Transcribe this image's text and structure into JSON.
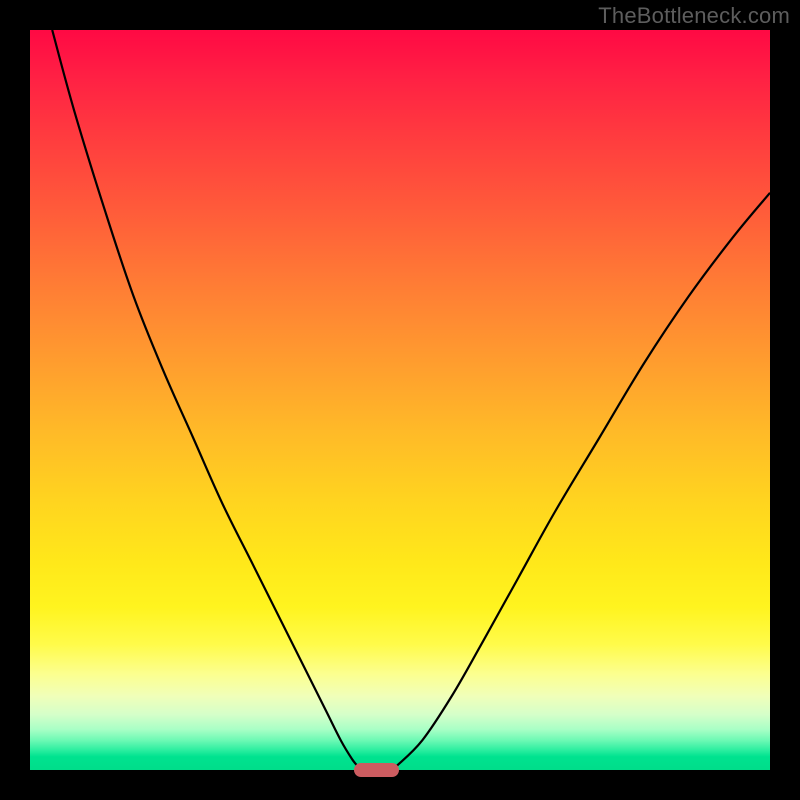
{
  "watermark": "TheBottleneck.com",
  "colors": {
    "frame": "#000000",
    "curve": "#000000",
    "marker": "#cc5c60",
    "watermark": "#5d5d5d"
  },
  "chart_data": {
    "type": "line",
    "title": "",
    "xlabel": "",
    "ylabel": "",
    "xlim": [
      0,
      100
    ],
    "ylim": [
      0,
      100
    ],
    "grid": false,
    "legend": false,
    "annotations": [
      "TheBottleneck.com"
    ],
    "series": [
      {
        "name": "left-branch",
        "x": [
          3,
          6,
          10,
          14,
          18,
          22,
          26,
          30,
          34,
          37,
          40,
          42,
          43.5,
          44.3
        ],
        "y": [
          100,
          89,
          76,
          64,
          54,
          45,
          36,
          28,
          20,
          14,
          8,
          4,
          1.5,
          0.5
        ]
      },
      {
        "name": "right-branch",
        "x": [
          49.5,
          53,
          57,
          61,
          66,
          71,
          77,
          83,
          89,
          95,
          100
        ],
        "y": [
          0.5,
          4,
          10,
          17,
          26,
          35,
          45,
          55,
          64,
          72,
          78
        ]
      }
    ],
    "marker": {
      "x": 46.8,
      "y": 0,
      "width_pct": 6.1,
      "height_pct": 1.8
    },
    "background_gradient": {
      "orientation": "vertical",
      "stops": [
        {
          "pos": 0.0,
          "color": "#ff0944"
        },
        {
          "pos": 0.5,
          "color": "#ffb928"
        },
        {
          "pos": 0.85,
          "color": "#fffb4a"
        },
        {
          "pos": 1.0,
          "color": "#00dd8a"
        }
      ]
    }
  }
}
